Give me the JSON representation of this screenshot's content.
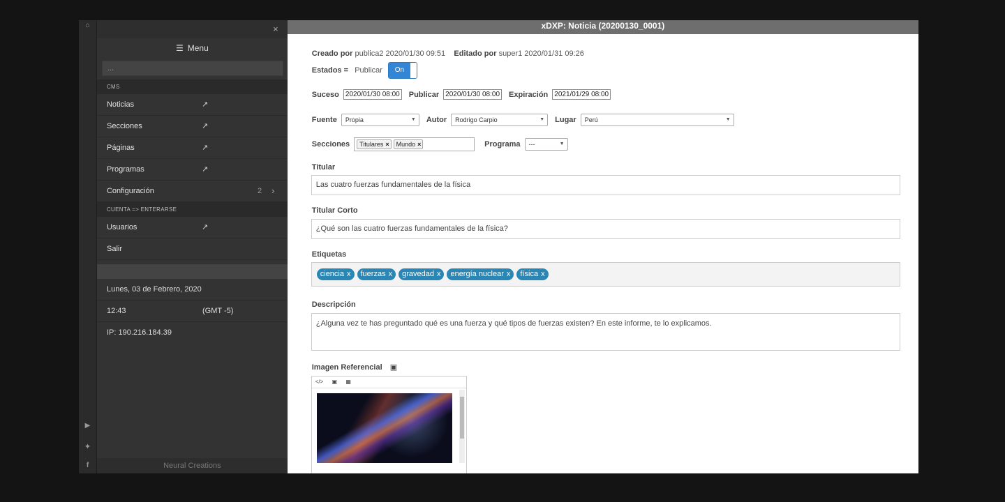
{
  "strip": {
    "home_icon": "home-icon",
    "youtube_icon": "youtube-icon",
    "twitter_icon": "twitter-icon",
    "facebook_icon": "facebook-icon"
  },
  "sidebar": {
    "close": "×",
    "menu_label": "Menu",
    "search_placeholder": "...",
    "section_cms": "CMS",
    "items": [
      {
        "label": "Noticias"
      },
      {
        "label": "Secciones"
      },
      {
        "label": "Páginas"
      },
      {
        "label": "Programas"
      },
      {
        "label": "Configuración",
        "count": "2"
      }
    ],
    "section_account": "CUENTA => ENTERARSE",
    "account_items": [
      {
        "label": "Usuarios"
      },
      {
        "label": "Salir"
      }
    ],
    "date": "Lunes, 03 de Febrero, 2020",
    "time": "12:43",
    "tz": "(GMT -5)",
    "ip": "IP: 190.216.184.39",
    "footer": "Neural Creations"
  },
  "main": {
    "title": "xDXP: Noticia (20200130_0001)",
    "created_label": "Creado por",
    "created_value": "publica2 2020/01/30 09:51",
    "edited_label": "Editado por",
    "edited_value": "super1 2020/01/31 09:26",
    "estados_label": "Estados =",
    "estados_value": "Publicar",
    "toggle_on": "On",
    "suceso_label": "Suceso",
    "suceso_value": "2020/01/30 08:00",
    "publicar_label": "Publicar",
    "publicar_value": "2020/01/30 08:00",
    "expiracion_label": "Expiración",
    "expiracion_value": "2021/01/29 08:00",
    "fuente_label": "Fuente",
    "fuente_value": "Propia",
    "autor_label": "Autor",
    "autor_value": "Rodrigo Carpio",
    "lugar_label": "Lugar",
    "lugar_value": "Perú",
    "secciones_label": "Secciones",
    "secciones_chips": [
      "Titulares",
      "Mundo"
    ],
    "programa_label": "Programa",
    "programa_value": "---",
    "titular_label": "Titular",
    "titular_value": "Las cuatro fuerzas fundamentales de la física",
    "titular_corto_label": "Titular Corto",
    "titular_corto_value": "¿Qué son las cuatro fuerzas fundamentales de la física?",
    "etiquetas_label": "Etiquetas",
    "etiquetas": [
      "ciencia",
      "fuerzas",
      "gravedad",
      "energía nuclear",
      "física"
    ],
    "descripcion_label": "Descripción",
    "descripcion_value": "¿Alguna vez te has preguntado qué es una fuerza y qué tipos de fuerzas existen? En este informe, te lo explicamos.",
    "imagen_label": "Imagen Referencial"
  },
  "colors": {
    "accent": "#3385d6",
    "tag": "#2a87b5",
    "sidebar": "#333333",
    "titlebar": "#6e6e6e"
  }
}
